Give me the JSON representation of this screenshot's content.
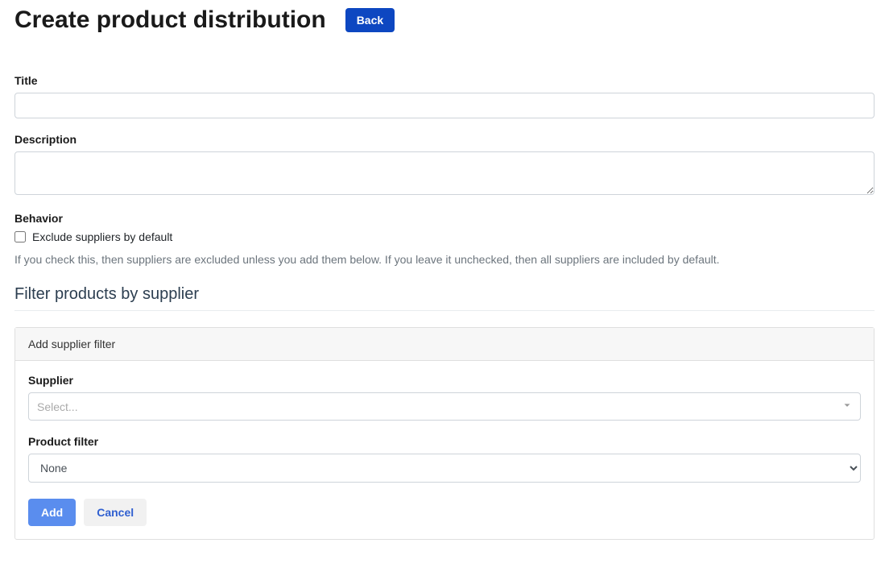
{
  "header": {
    "title": "Create product distribution",
    "back_label": "Back"
  },
  "form": {
    "title": {
      "label": "Title",
      "value": ""
    },
    "description": {
      "label": "Description",
      "value": ""
    },
    "behavior": {
      "label": "Behavior",
      "checkbox_label": "Exclude suppliers by default",
      "help": "If you check this, then suppliers are excluded unless you add them below. If you leave it unchecked, then all suppliers are included by default."
    }
  },
  "filter_section": {
    "heading": "Filter products by supplier",
    "card_title": "Add supplier filter",
    "supplier": {
      "label": "Supplier",
      "placeholder": "Select..."
    },
    "product_filter": {
      "label": "Product filter",
      "selected": "None"
    },
    "add_label": "Add",
    "cancel_label": "Cancel"
  }
}
